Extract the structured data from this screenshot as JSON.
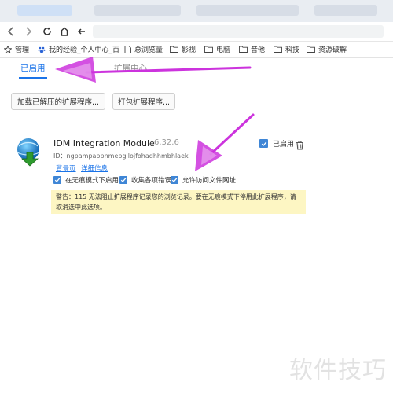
{
  "browser": {
    "address_text": "",
    "bookmarks": [
      {
        "label": "管理",
        "icon": "star-icon"
      },
      {
        "label": "我的经验_个人中心_百",
        "icon": "paw-icon"
      },
      {
        "label": "总浏览量",
        "icon": "file-icon"
      },
      {
        "label": "影视",
        "icon": "folder-icon"
      },
      {
        "label": "电脑",
        "icon": "folder-icon"
      },
      {
        "label": "音他",
        "icon": "folder-icon"
      },
      {
        "label": "科技",
        "icon": "folder-icon"
      },
      {
        "label": "资源破解",
        "icon": "folder-icon"
      }
    ]
  },
  "extensions_page": {
    "tabs": [
      {
        "label": "已启用",
        "active": true
      },
      {
        "label": "扩展中心",
        "active": false
      }
    ],
    "buttons": {
      "load_unpacked": "加载已解压的扩展程序...",
      "pack": "打包扩展程序..."
    }
  },
  "extension": {
    "name": "IDM Integration Module",
    "version": "6.32.6",
    "id_label": "ID：",
    "id_value": "ngpampappnmepgilojfohadhhmbhlaek",
    "links": {
      "background": "背景页",
      "details": "详细信息"
    },
    "enabled_label": "已启用",
    "options": [
      {
        "label": "在无痕模式下启用",
        "checked": true
      },
      {
        "label": "收集各项错误",
        "checked": true
      },
      {
        "label": "允许访问文件网址",
        "checked": true
      }
    ],
    "warning": "警告：115 无法阻止扩展程序记录您的浏览记录。要在无痕模式下停用此扩展程序，请取消选中此选项。"
  },
  "watermark": "软件技巧",
  "colors": {
    "accent": "#1a73e8",
    "checkbox": "#3f86d6",
    "warning_bg": "#fdf6c3",
    "annotation_arrow": "#cc33dd"
  }
}
